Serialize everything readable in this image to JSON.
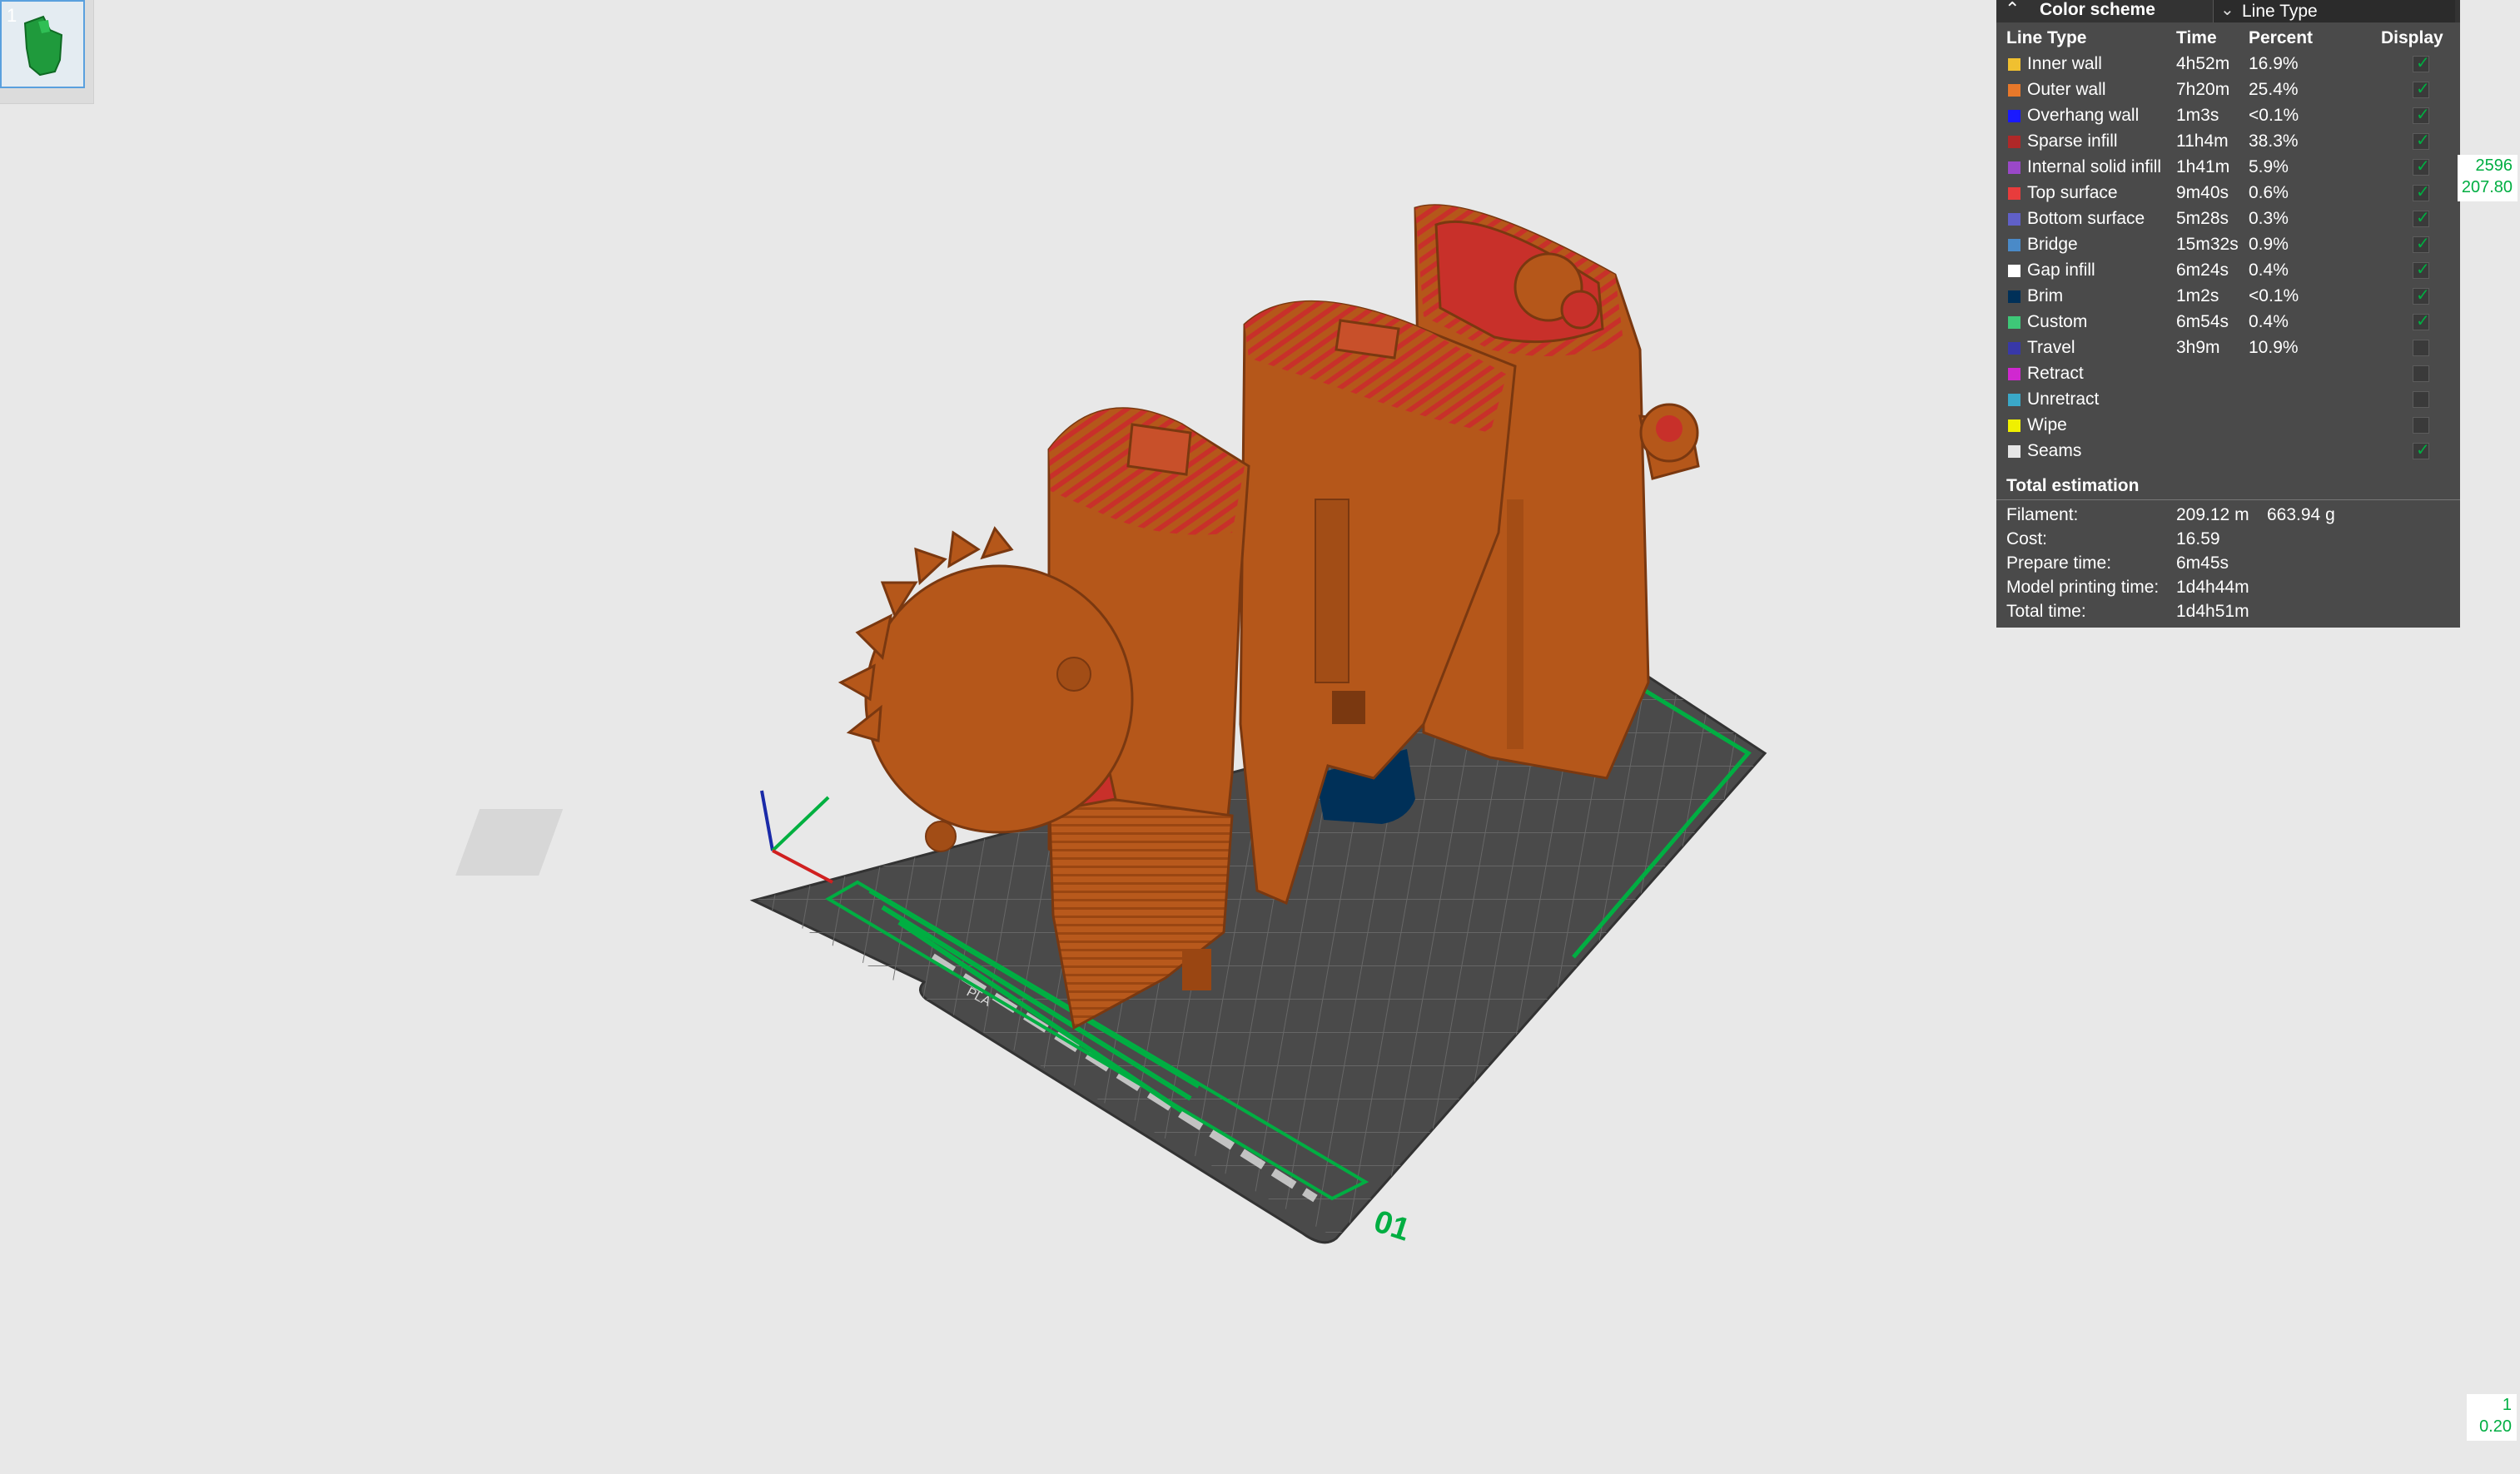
{
  "plate_thumbnail": {
    "index": "1"
  },
  "legend": {
    "title": "Color scheme",
    "scheme_value": "Line Type",
    "columns": {
      "type": "Line Type",
      "time": "Time",
      "percent": "Percent",
      "display": "Display"
    },
    "rows": [
      {
        "name": "Inner wall",
        "time": "4h52m",
        "percent": "16.9%",
        "color": "#f0c030",
        "display": true
      },
      {
        "name": "Outer wall",
        "time": "7h20m",
        "percent": "25.4%",
        "color": "#e8782a",
        "display": true
      },
      {
        "name": "Overhang wall",
        "time": "1m3s",
        "percent": "<0.1%",
        "color": "#1a1aff",
        "display": true
      },
      {
        "name": "Sparse infill",
        "time": "11h4m",
        "percent": "38.3%",
        "color": "#b02828",
        "display": true
      },
      {
        "name": "Internal solid infill",
        "time": "1h41m",
        "percent": "5.9%",
        "color": "#9a48c8",
        "display": true
      },
      {
        "name": "Top surface",
        "time": "9m40s",
        "percent": "0.6%",
        "color": "#e83c3c",
        "display": true
      },
      {
        "name": "Bottom surface",
        "time": "5m28s",
        "percent": "0.3%",
        "color": "#6060c8",
        "display": true
      },
      {
        "name": "Bridge",
        "time": "15m32s",
        "percent": "0.9%",
        "color": "#4a8ac8",
        "display": true
      },
      {
        "name": "Gap infill",
        "time": "6m24s",
        "percent": "0.4%",
        "color": "#ffffff",
        "display": true
      },
      {
        "name": "Brim",
        "time": "1m2s",
        "percent": "<0.1%",
        "color": "#003058",
        "display": true
      },
      {
        "name": "Custom",
        "time": "6m54s",
        "percent": "0.4%",
        "color": "#3ec878",
        "display": true
      },
      {
        "name": "Travel",
        "time": "3h9m",
        "percent": "10.9%",
        "color": "#3838a8",
        "display": false
      },
      {
        "name": "Retract",
        "time": "",
        "percent": "",
        "color": "#d028d0",
        "display": false
      },
      {
        "name": "Unretract",
        "time": "",
        "percent": "",
        "color": "#3aa8c8",
        "display": false
      },
      {
        "name": "Wipe",
        "time": "",
        "percent": "",
        "color": "#f0f000",
        "display": false
      },
      {
        "name": "Seams",
        "time": "",
        "percent": "",
        "color": "#e6e6e6",
        "display": true
      }
    ],
    "total_title": "Total estimation",
    "estimates": {
      "filament_label": "Filament:",
      "filament_length": "209.12 m",
      "filament_weight": "663.94 g",
      "cost_label": "Cost:",
      "cost": "16.59",
      "prepare_label": "Prepare time:",
      "prepare": "6m45s",
      "model_label": "Model printing time:",
      "model": "1d4h44m",
      "total_label": "Total time:",
      "total": "1d4h51m"
    }
  },
  "layer_slider": {
    "top_layer": "2596",
    "top_height": "207.80",
    "bottom_layer": "1",
    "bottom_height": "0.20"
  },
  "plate_label": "01",
  "plate_marking": "PLA",
  "colors": {
    "accent": "#00ae42",
    "model": "#b5571a",
    "top_surface": "#c8302a",
    "plate": "#4a4a4a"
  }
}
